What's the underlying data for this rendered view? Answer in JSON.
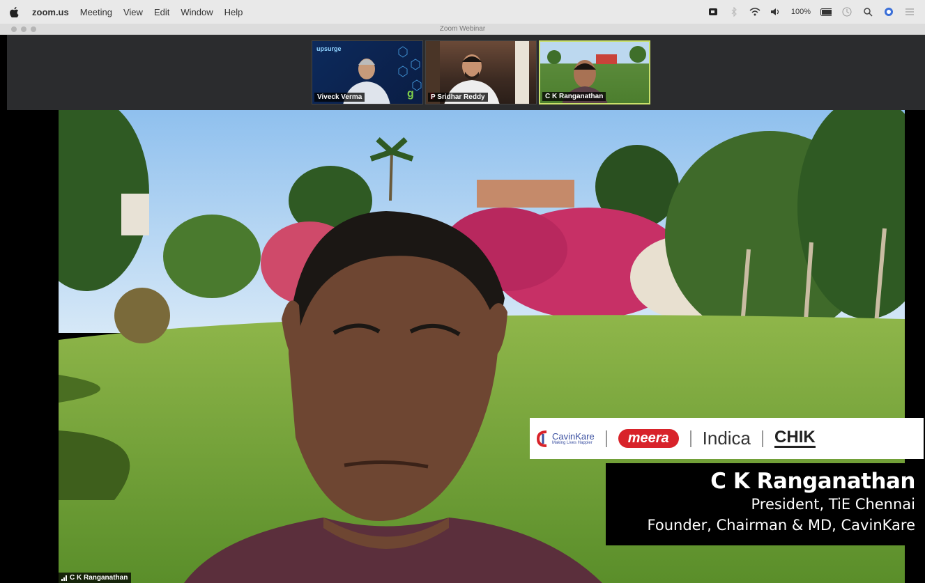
{
  "menubar": {
    "app_name": "zoom.us",
    "items": [
      "Meeting",
      "View",
      "Edit",
      "Window",
      "Help"
    ],
    "battery": "100%"
  },
  "window": {
    "title": "Zoom Webinar"
  },
  "gallery": [
    {
      "name": "Viveck Verma",
      "brand": "upsurge"
    },
    {
      "name": "P Sridhar Reddy"
    },
    {
      "name": "C K Ranganathan",
      "active": true
    }
  ],
  "logos": {
    "cavinkare": "CavinKare",
    "cavinkare_tagline": "Making Lives Happier",
    "meera": "meera",
    "indica": "Indica",
    "chik": "CHIK"
  },
  "nameplate": {
    "name": "C K Ranganathan",
    "title1": "President, TiE Chennai",
    "title2": "Founder, Chairman & MD, CavinKare"
  },
  "active_speaker": {
    "name": "C K Ranganathan"
  },
  "colors": {
    "active_border": "#c9e06a",
    "meera_red": "#d8232a",
    "gallery_bg": "#2b2c2e"
  }
}
